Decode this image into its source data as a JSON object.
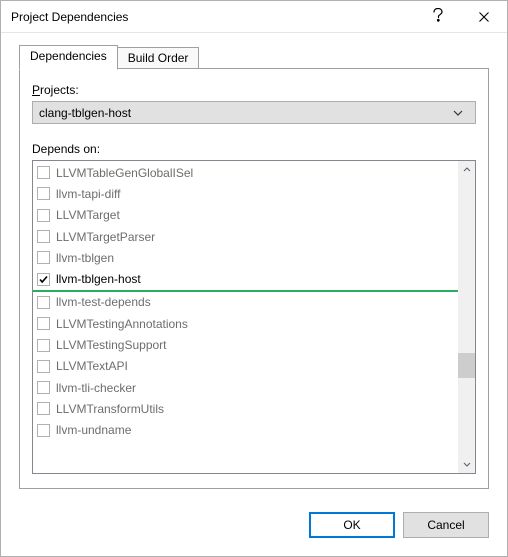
{
  "window": {
    "title": "Project Dependencies",
    "help_icon": "help-icon",
    "close_icon": "close-icon"
  },
  "tabs": {
    "active": "Dependencies",
    "items": [
      {
        "label": "Dependencies",
        "active": true
      },
      {
        "label": "Build Order",
        "active": false
      }
    ]
  },
  "projects": {
    "label_prefix": "P",
    "label_rest": "rojects:",
    "selected": "clang-tblgen-host"
  },
  "depends": {
    "label": "Depends on:",
    "items": [
      {
        "label": "LLVMTableGenGlobalISel",
        "checked": false,
        "enabled": false
      },
      {
        "label": "llvm-tapi-diff",
        "checked": false,
        "enabled": false
      },
      {
        "label": "LLVMTarget",
        "checked": false,
        "enabled": false
      },
      {
        "label": "LLVMTargetParser",
        "checked": false,
        "enabled": false
      },
      {
        "label": "llvm-tblgen",
        "checked": false,
        "enabled": false
      },
      {
        "label": "llvm-tblgen-host",
        "checked": true,
        "enabled": true
      },
      {
        "label": "llvm-test-depends",
        "checked": false,
        "enabled": false
      },
      {
        "label": "LLVMTestingAnnotations",
        "checked": false,
        "enabled": false
      },
      {
        "label": "LLVMTestingSupport",
        "checked": false,
        "enabled": false
      },
      {
        "label": "LLVMTextAPI",
        "checked": false,
        "enabled": false
      },
      {
        "label": "llvm-tli-checker",
        "checked": false,
        "enabled": false
      },
      {
        "label": "LLVMTransformUtils",
        "checked": false,
        "enabled": false
      },
      {
        "label": "llvm-undname",
        "checked": false,
        "enabled": false
      }
    ],
    "highlight_after_index": 5,
    "scroll": {
      "thumb_top_frac": 0.63,
      "thumb_height_frac": 0.09
    }
  },
  "buttons": {
    "ok": "OK",
    "cancel": "Cancel"
  }
}
